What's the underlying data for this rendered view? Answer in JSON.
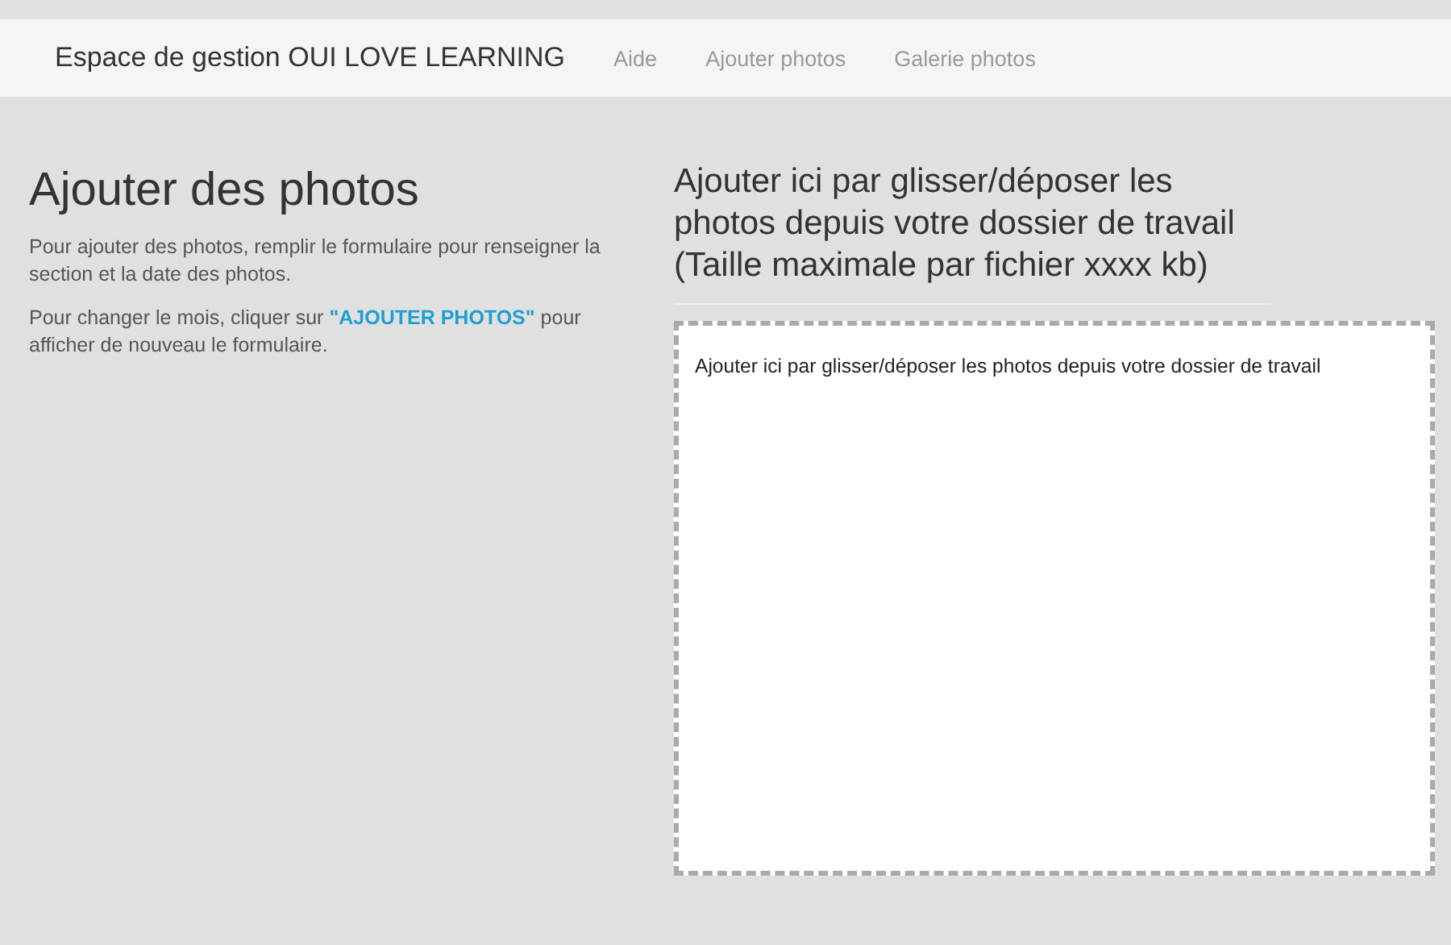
{
  "navbar": {
    "brand": "Espace de gestion OUI LOVE LEARNING",
    "links": [
      {
        "label": "Aide"
      },
      {
        "label": "Ajouter photos"
      },
      {
        "label": "Galerie photos"
      }
    ]
  },
  "intro": {
    "title": "Ajouter des photos",
    "paragraph": "Pour ajouter des photos, remplir le formulaire pour renseigner la section et la date des photos.",
    "hint": {
      "before": "Pour changer le mois, cliquer sur ",
      "link": "\"AJOUTER PHOTOS\"",
      "after": " pour afficher de nouveau le formulaire."
    }
  },
  "upload": {
    "title": "Ajouter ici par glisser/déposer les photos depuis votre dossier de travail (Taille maximale par fichier xxxx kb)",
    "dropzone": {
      "message": "Ajouter ici par glisser/déposer les photos depuis votre dossier de travail"
    }
  }
}
